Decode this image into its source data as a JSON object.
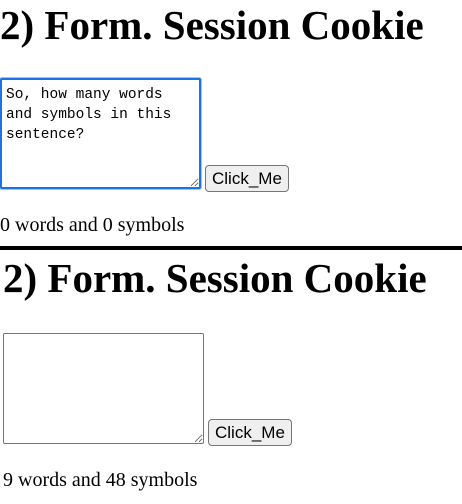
{
  "sections": [
    {
      "heading": "2) Form. Session Cookie",
      "textarea_value": "So, how many words and symbols in this sentence?",
      "button_label": "Click_Me",
      "result_text": "0 words and 0 symbols"
    },
    {
      "heading": "2) Form. Session Cookie",
      "textarea_value": "",
      "button_label": "Click_Me",
      "result_text": "9 words and 48 symbols"
    }
  ],
  "colors": {
    "focus_border": "#1a73e8",
    "button_bg": "#efefef",
    "divider": "#000000"
  }
}
